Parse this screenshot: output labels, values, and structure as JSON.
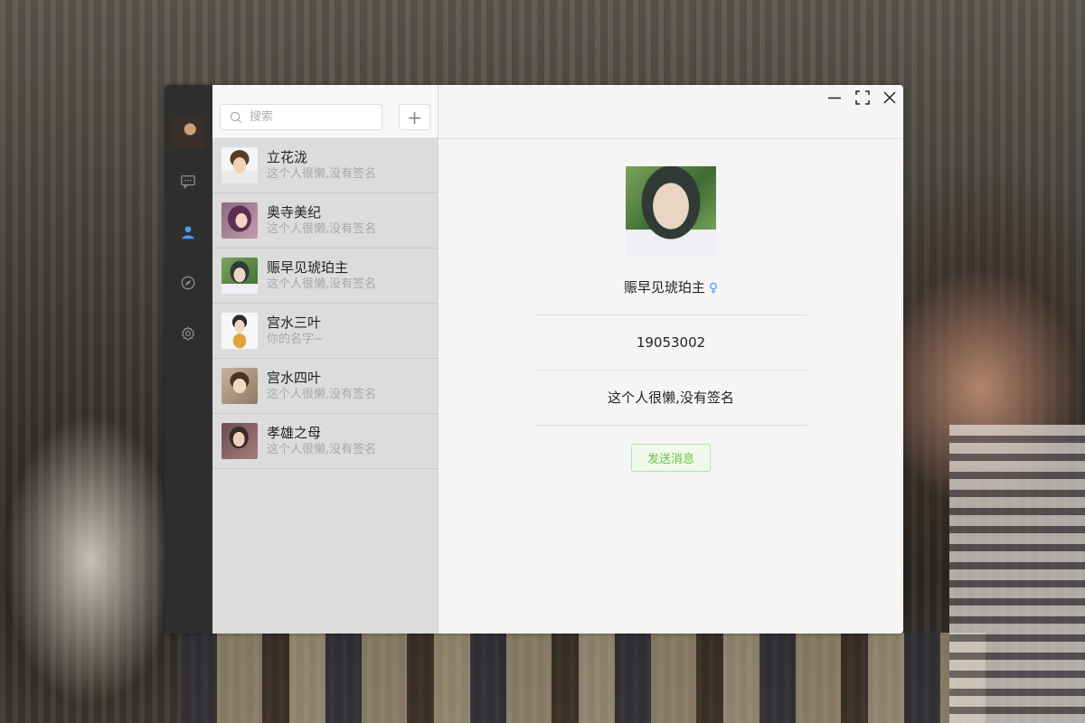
{
  "search": {
    "placeholder": "搜索",
    "add_label": "+"
  },
  "contacts": [
    {
      "name": "立花泷",
      "signature": "这个人很懒,没有签名"
    },
    {
      "name": "奥寺美纪",
      "signature": "这个人很懒,没有签名"
    },
    {
      "name": "赈早见琥珀主",
      "signature": "这个人很懒,没有签名"
    },
    {
      "name": "宫水三叶",
      "signature": "你的名字~"
    },
    {
      "name": "宫水四叶",
      "signature": "这个人很懒,没有签名"
    },
    {
      "name": "孝雄之母",
      "signature": "这个人很懒,没有签名"
    }
  ],
  "profile": {
    "name": "赈早见琥珀主",
    "gender_symbol": "♀",
    "id": "19053002",
    "signature": "这个人很懒,没有签名",
    "send_label": "发送消息"
  },
  "icons": {
    "rail": [
      "chat-icon",
      "contacts-icon",
      "compass-icon",
      "settings-icon"
    ],
    "window": [
      "minimize-icon",
      "maximize-icon",
      "close-icon"
    ]
  },
  "colors": {
    "rail_bg": "#2e2e2e",
    "active_icon": "#4a9af0",
    "send_green": "#67c23a",
    "list_bg": "#dcdcdc",
    "detail_bg": "#f5f5f5"
  }
}
